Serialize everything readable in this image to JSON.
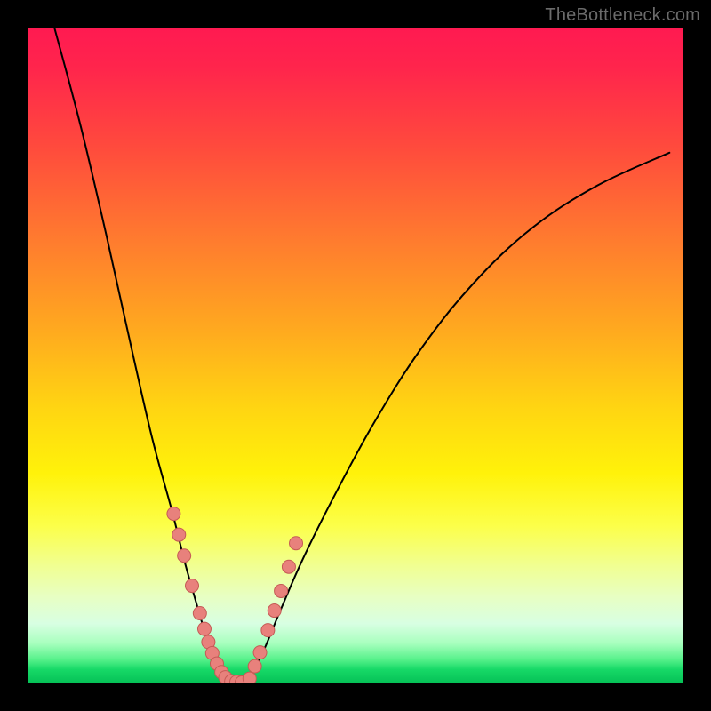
{
  "watermark": {
    "text": "TheBottleneck.com"
  },
  "colors": {
    "black": "#000000",
    "curve": "#000000",
    "marker_fill": "#e8817c",
    "marker_stroke": "#c55a55"
  },
  "chart_data": {
    "type": "line",
    "title": "",
    "xlabel": "",
    "ylabel": "",
    "xlim": [
      0,
      100
    ],
    "ylim": [
      0,
      100
    ],
    "note": "No axis ticks or numeric labels are rendered; x and y values are estimated as percentages of the plot area (0 = left/bottom, 100 = right/top).",
    "series": [
      {
        "name": "left-curve",
        "type": "line",
        "x": [
          4,
          8,
          12,
          16,
          19,
          22,
          24,
          26,
          27.5,
          29,
          30,
          30.8
        ],
        "y": [
          100,
          85,
          68,
          50,
          37,
          26,
          18,
          11,
          6,
          2.5,
          0.8,
          0
        ]
      },
      {
        "name": "right-curve",
        "type": "line",
        "x": [
          33,
          34.2,
          36,
          38.5,
          42,
          47,
          53,
          60,
          68,
          77,
          87,
          98
        ],
        "y": [
          0,
          1.5,
          5,
          11,
          19,
          29,
          40,
          51,
          61,
          69.5,
          76,
          81
        ]
      },
      {
        "name": "left-markers",
        "type": "scatter",
        "x": [
          22.2,
          23.0,
          23.8,
          25.0,
          26.2,
          26.9,
          27.5,
          28.1,
          28.8,
          29.5,
          30.1,
          31.0,
          31.8,
          32.6
        ],
        "y": [
          25.8,
          22.6,
          19.4,
          14.8,
          10.6,
          8.2,
          6.2,
          4.5,
          2.9,
          1.6,
          0.8,
          0.2,
          0.1,
          0.0
        ]
      },
      {
        "name": "right-markers",
        "type": "scatter",
        "x": [
          33.8,
          34.6,
          35.4,
          36.6,
          37.6,
          38.6,
          39.8,
          40.9
        ],
        "y": [
          0.6,
          2.5,
          4.6,
          8.0,
          11.0,
          14.0,
          17.7,
          21.3
        ]
      }
    ]
  }
}
